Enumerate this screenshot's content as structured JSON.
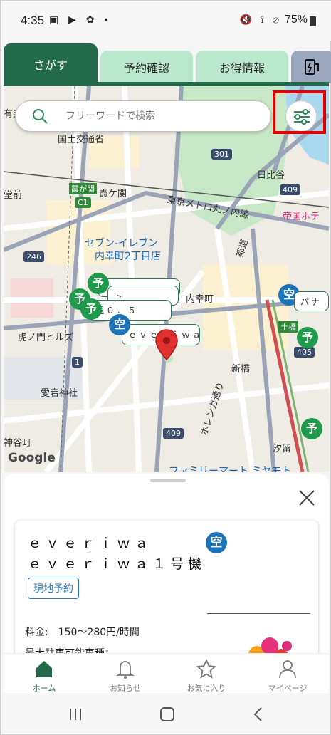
{
  "status": {
    "time": "4:35",
    "battery": "75%",
    "left_icons": "▣ ▶ ✿ •",
    "right_icons": "🔇 ⟟ ⊘"
  },
  "tabs": [
    {
      "label": "さがす"
    },
    {
      "label": "予約確認"
    },
    {
      "label": "お得情報"
    }
  ],
  "search": {
    "placeholder": "フリーワードで検索"
  },
  "map_labels": {
    "l1": "有楽",
    "l2": "国土交通省",
    "l3": "日比谷",
    "l4": "霞ケ関",
    "l5": "霞が関",
    "l6": "東京メトロ丸ノ内線",
    "l7": "帝国ホテ",
    "l8": "セブン-イレブン",
    "l9": "内幸町2丁目店",
    "l10": "内幸町",
    "l11": "虎ノ門ヒルズ",
    "l12": "新橋",
    "l13": "愛宕神社",
    "l14": "汐留",
    "l15": "ファミリーマート ミヤモト",
    "l16": "Google",
    "l17": "日比谷",
    "l18": "都道",
    "l19": "ホレンガ通り",
    "l20": "堂前",
    "l21": "神谷町",
    "l22": "パナ",
    "l23": "土橋",
    "road1": "301",
    "road2": "409",
    "road3": "246",
    "road4": "C1",
    "road5": "405",
    "road6": "409",
    "road7": "1"
  },
  "callouts": {
    "c1": "ト",
    "c2": "理０．５",
    "c3": "ｅｖｅｒｉｗａ"
  },
  "pins": {
    "yo": "予",
    "sora": "空"
  },
  "card": {
    "name_line1": "ｅｖｅｒｉｗａ",
    "name_line2": "ｅｖｅｒｉｗａ１号機",
    "badge": "現地予約",
    "sora": "空",
    "price": "料金:　150～280円/時間",
    "next": "最大駐車可能車種："
  },
  "nav": [
    {
      "label": "ホーム"
    },
    {
      "label": "お知らせ"
    },
    {
      "label": "お気に入り"
    },
    {
      "label": "マイページ"
    }
  ],
  "colors": {
    "primary": "#236a4b",
    "tab_inactive": "#b9e8cf",
    "highlight": "#e40000"
  }
}
